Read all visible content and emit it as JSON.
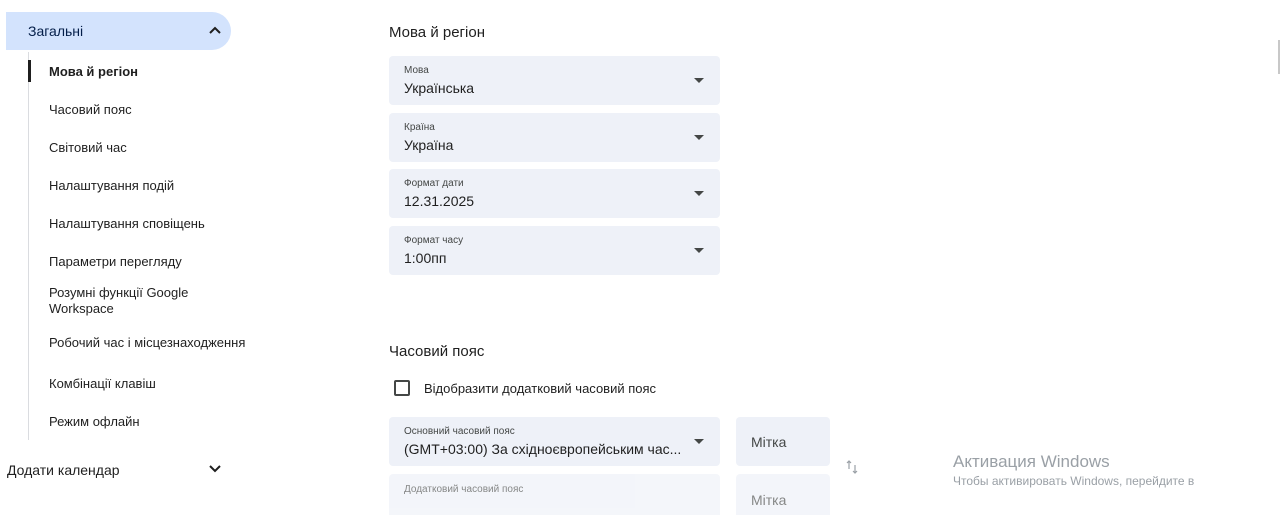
{
  "sidebar": {
    "group_label": "Загальні",
    "items": [
      {
        "label": "Мова й регіон",
        "active": true
      },
      {
        "label": "Часовий пояс"
      },
      {
        "label": "Світовий час"
      },
      {
        "label": "Налаштування подій"
      },
      {
        "label": "Налаштування сповіщень"
      },
      {
        "label": "Параметри перегляду"
      },
      {
        "label": "Розумні функції Google Workspace"
      },
      {
        "label": "Робочий час і місцезнаходження"
      },
      {
        "label": "Комбінації клавіш"
      },
      {
        "label": "Режим офлайн"
      }
    ],
    "add_calendar_label": "Додати календар"
  },
  "language_region": {
    "title": "Мова й регіон",
    "language": {
      "label": "Мова",
      "value": "Українська"
    },
    "country": {
      "label": "Країна",
      "value": "Україна"
    },
    "date_format": {
      "label": "Формат дати",
      "value": "12.31.2025"
    },
    "time_format": {
      "label": "Формат часу",
      "value": "1:00пп"
    }
  },
  "timezone": {
    "title": "Часовий пояс",
    "show_secondary_label": "Відобразити додатковий часовий пояс",
    "primary": {
      "label": "Основний часовий пояс",
      "value": "(GMT+03:00) За східноєвропейським час..."
    },
    "primary_tag_placeholder": "Мітка",
    "secondary": {
      "label": "Додатковий часовий пояс"
    },
    "secondary_tag_placeholder": "Мітка"
  },
  "windows_watermark": {
    "title": "Активация Windows",
    "subtitle": "Чтобы активировать Windows, перейдите в"
  },
  "colors": {
    "accent_bg": "#d3e3fd",
    "field_bg": "#eef1f8"
  }
}
